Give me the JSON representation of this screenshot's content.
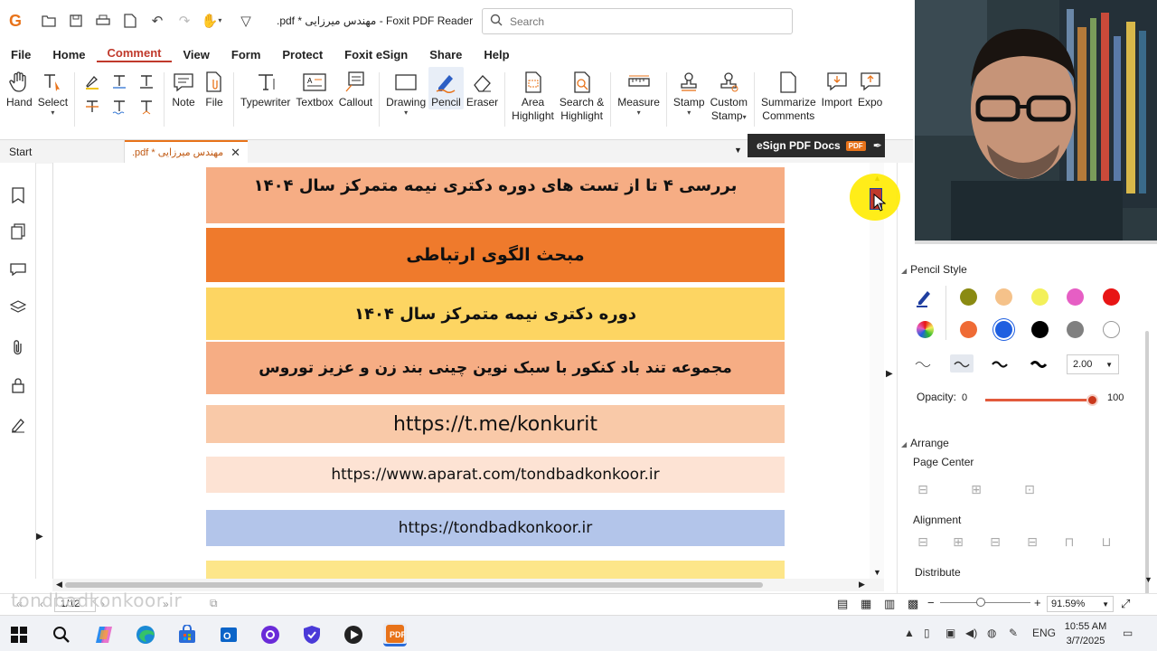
{
  "window": {
    "title": ".pdf * مهندس میرزایی - Foxit PDF Reader",
    "search_placeholder": "Search"
  },
  "menu": [
    "File",
    "Home",
    "Comment",
    "View",
    "Form",
    "Protect",
    "Foxit eSign",
    "Share",
    "Help"
  ],
  "menu_active": "Comment",
  "ribbon": {
    "hand": "Hand",
    "select": "Select",
    "note": "Note",
    "file": "File",
    "typewriter": "Typewriter",
    "textbox": "Textbox",
    "callout": "Callout",
    "drawing": "Drawing",
    "pencil": "Pencil",
    "eraser": "Eraser",
    "area_highlight_1": "Area",
    "area_highlight_2": "Highlight",
    "search_highlight_1": "Search &",
    "search_highlight_2": "Highlight",
    "measure": "Measure",
    "stamp": "Stamp",
    "custom_stamp_1": "Custom",
    "custom_stamp_2": "Stamp",
    "summarize_1": "Summarize",
    "summarize_2": "Comments",
    "import": "Import",
    "export": "Expo"
  },
  "tabs": {
    "start": "Start",
    "doc": ".pdf * مهندس میرزایی",
    "esign": "eSign PDF Docs",
    "esign_badge": "PDF"
  },
  "document": {
    "bands": [
      {
        "text": "بررسی ۴ تا از تست های دوره دکتری نیمه متمرکز سال ۱۴۰۴",
        "color": "#f6ad84"
      },
      {
        "text": "مبحث الگوی ارتباطی",
        "color": "#ef7a2c"
      },
      {
        "text": "دوره دکتری نیمه متمرکز سال ۱۴۰۴",
        "color": "#fdd562"
      },
      {
        "text": "مجموعه تند باد کنکور با سبک نوین چینی بند زن و عزیز توروس",
        "color": "#f6ad84"
      },
      {
        "text": "https://t.me/konkurit",
        "color": "#f9c9a8"
      },
      {
        "text": "https://www.aparat.com/tondbadkonkoor.ir",
        "color": "#fde3d4"
      },
      {
        "text": "https://tondbadkonkoor.ir",
        "color": "#b3c5ea"
      },
      {
        "text": "",
        "color": "#fde68a"
      }
    ]
  },
  "right_panel": {
    "pencil_style": "Pencil Style",
    "stroke_width": "2.00",
    "opacity_label": "Opacity:",
    "opacity_min": "0",
    "opacity_max": "100",
    "opacity_value": 100,
    "arrange": "Arrange",
    "page_center": "Page Center",
    "alignment": "Alignment",
    "distribute": "Distribute",
    "colors_row1": [
      "#8a8a12",
      "#f5c28a",
      "#f3f05a",
      "#e65ec4",
      "#e81414"
    ],
    "colors_row2": [
      "#ef6b35",
      "#1f5fe0",
      "#000000",
      "#808080",
      "#ffffff"
    ]
  },
  "status": {
    "page": "1/12",
    "zoom": "91.59%",
    "watermark": "tondbadkonkoor.ir"
  },
  "taskbar": {
    "lang": "ENG",
    "time": "10:55 AM",
    "date": "3/7/2025"
  }
}
